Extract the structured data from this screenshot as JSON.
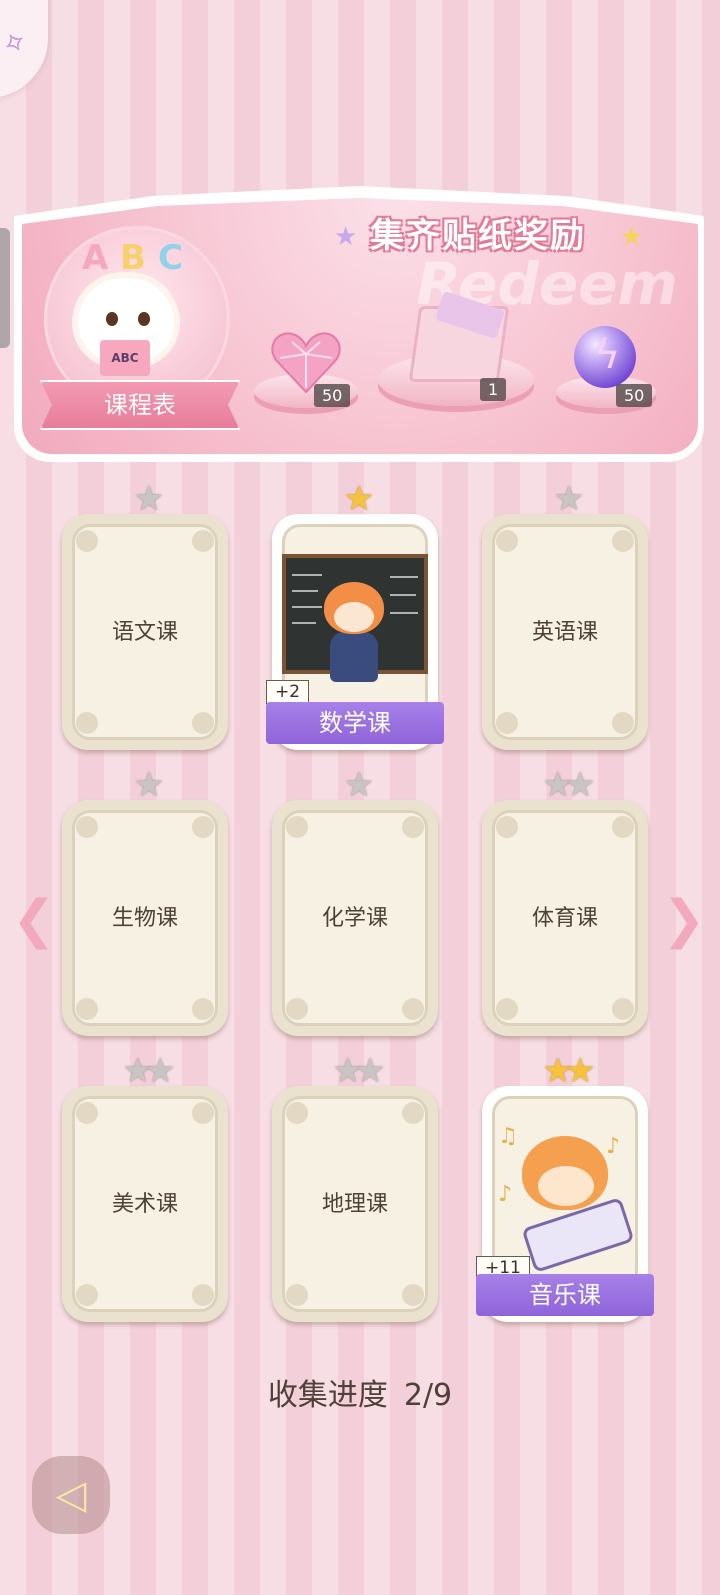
{
  "banner": {
    "title": "集齐贴纸奖励",
    "watermark": "Redeem",
    "schedule_label": "课程表",
    "book_text": "ABC",
    "abc_letters": [
      "A",
      "B",
      "C"
    ],
    "rewards": [
      {
        "name": "heart-gem",
        "count": "50"
      },
      {
        "name": "gift-box",
        "count": "1"
      },
      {
        "name": "lightning-orb",
        "count": "50"
      }
    ]
  },
  "cards": [
    {
      "label": "语文课",
      "stars": 1,
      "unlocked": false
    },
    {
      "label": "数学课",
      "stars": 1,
      "unlocked": true,
      "bonus": "+2"
    },
    {
      "label": "英语课",
      "stars": 1,
      "unlocked": false
    },
    {
      "label": "生物课",
      "stars": 1,
      "unlocked": false
    },
    {
      "label": "化学课",
      "stars": 1,
      "unlocked": false
    },
    {
      "label": "体育课",
      "stars": 2,
      "unlocked": false
    },
    {
      "label": "美术课",
      "stars": 2,
      "unlocked": false
    },
    {
      "label": "地理课",
      "stars": 2,
      "unlocked": false
    },
    {
      "label": "音乐课",
      "stars": 2,
      "unlocked": true,
      "bonus": "+11"
    }
  ],
  "progress": {
    "label": "收集进度",
    "value": "2/9"
  },
  "colors": {
    "accent_purple": "#9a72df",
    "pink": "#f3a9bd",
    "gold_star": "#f5c33d",
    "gray_star": "#c9c5c3"
  },
  "icons": {
    "back": "back-arrow-icon",
    "prev": "chevron-left-icon",
    "next": "chevron-right-icon",
    "star": "star-icon"
  }
}
